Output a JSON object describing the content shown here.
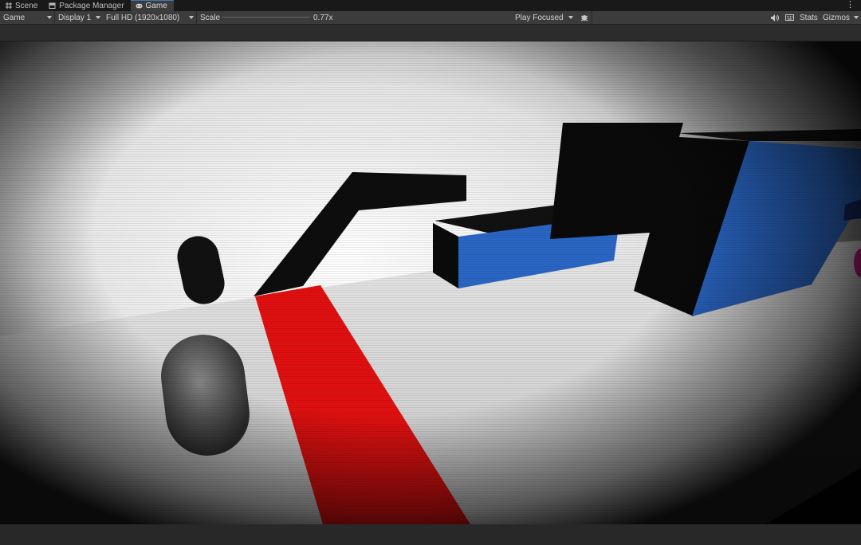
{
  "tabs": [
    {
      "label": "Scene",
      "icon": "grid-icon"
    },
    {
      "label": "Package Manager",
      "icon": "package-icon"
    },
    {
      "label": "Game",
      "icon": "gamepad-icon",
      "active": true
    }
  ],
  "toolbar": {
    "view_mode": "Game",
    "display": "Display 1",
    "resolution": "Full HD (1920x1080)",
    "scale_label": "Scale",
    "scale_value": "0.77x",
    "play_mode": "Play Focused",
    "stats_label": "Stats",
    "gizmos_label": "Gizmos"
  },
  "colors": {
    "tab_bg": "#191919",
    "toolbar_bg": "#3c3c3c",
    "active_accent": "#3a79bb",
    "scene_red": "#e01010",
    "scene_blue": "#2a66c4",
    "scene_black": "#0a0a0a",
    "scene_floor": "#d9d9d9"
  }
}
